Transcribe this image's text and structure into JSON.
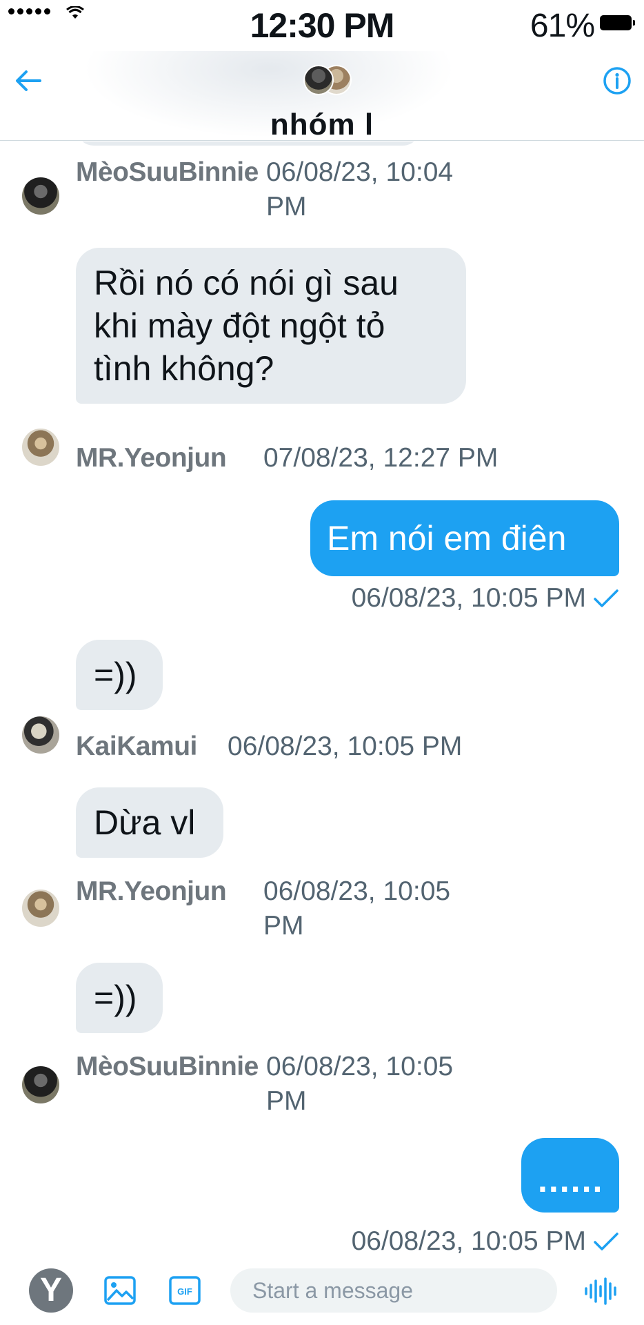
{
  "status_bar": {
    "time": "12:30 PM",
    "battery": "61%"
  },
  "header": {
    "title": "nhóm l",
    "back_icon": "arrow-left-icon",
    "info_icon": "info-icon",
    "accent": "#1da1f2"
  },
  "messages": [
    {
      "sender": "MèoSuuBinnie",
      "time": "06/08/23, 10:04 PM"
    },
    {
      "text": "Rồi nó có nói gì sau khi mày đột ngột tỏ tình không?",
      "sender": "MR.Yeonjun",
      "time": "07/08/23, 12:27 PM"
    },
    {
      "text": "Em nói em điên",
      "outgoing": true,
      "time": "06/08/23, 10:05 PM"
    },
    {
      "text": "=))",
      "sender": "KaiKamui",
      "time": "06/08/23, 10:05 PM"
    },
    {
      "text": "Dừa vl",
      "sender": "MR.Yeonjun",
      "time": "06/08/23, 10:05 PM"
    },
    {
      "text": "=))",
      "sender": "MèoSuuBinnie",
      "time": "06/08/23, 10:05 PM"
    },
    {
      "text": "......",
      "outgoing": true,
      "time": "06/08/23, 10:05 PM"
    }
  ],
  "composer": {
    "avatar_letter": "Y",
    "placeholder": "Start a message",
    "gif_label": "GIF"
  }
}
